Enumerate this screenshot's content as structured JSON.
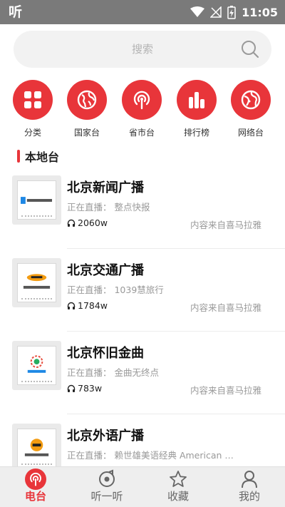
{
  "status_bar": {
    "app_glyph": "听",
    "time": "11:05",
    "icons": [
      "wifi-icon",
      "no-signal-icon",
      "battery-charging-icon"
    ]
  },
  "search": {
    "placeholder": "搜索"
  },
  "categories": [
    {
      "label": "分类",
      "icon": "grid-icon"
    },
    {
      "label": "国家台",
      "icon": "globe-icon"
    },
    {
      "label": "省市台",
      "icon": "broadcast-icon"
    },
    {
      "label": "排行榜",
      "icon": "bar-chart-icon"
    },
    {
      "label": "网络台",
      "icon": "network-globe-icon"
    }
  ],
  "section": {
    "title": "本地台"
  },
  "stations": [
    {
      "name": "北京新闻广播",
      "live": "正在直播： 整点快报",
      "listens": "2060w",
      "source": "内容来自喜马拉雅"
    },
    {
      "name": "北京交通广播",
      "live": "正在直播： 1039慧旅行",
      "listens": "1784w",
      "source": "内容来自喜马拉雅"
    },
    {
      "name": "北京怀旧金曲",
      "live": "正在直播： 金曲无终点",
      "listens": "783w",
      "source": "内容来自喜马拉雅"
    },
    {
      "name": "北京外语广播",
      "live": "正在直播： 赖世雄美语经典 American E...",
      "listens": "",
      "source": ""
    }
  ],
  "tabs": [
    {
      "label": "电台",
      "icon": "radio-icon",
      "active": true
    },
    {
      "label": "听一听",
      "icon": "disc-icon",
      "active": false
    },
    {
      "label": "收藏",
      "icon": "star-icon",
      "active": false
    },
    {
      "label": "我的",
      "icon": "user-icon",
      "active": false
    }
  ],
  "colors": {
    "accent": "#e8353a",
    "status_bar": "#7a7a7a",
    "tab_bar": "#eeeeee"
  }
}
